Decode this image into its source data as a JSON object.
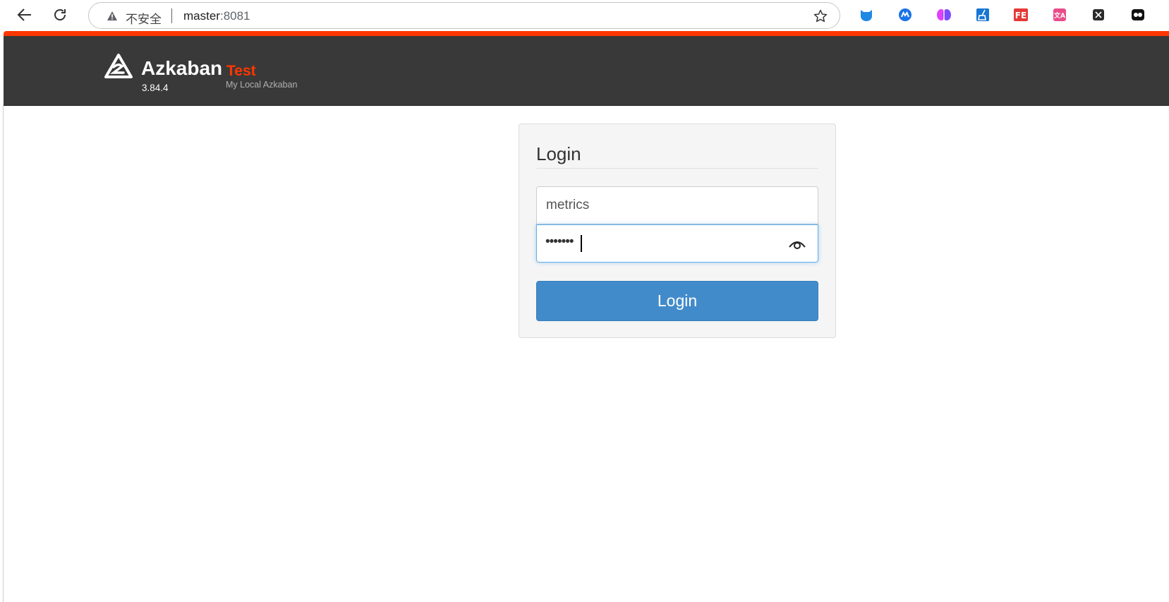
{
  "browser": {
    "security_label": "不安全",
    "url_host": "master",
    "url_port": ":8081",
    "extensions": [
      "cat-extension-icon",
      "edge-m-extension-icon",
      "brain-extension-icon",
      "broom-extension-icon",
      "fe-extension-icon",
      "translate-extension-icon",
      "x-extension-icon",
      "ghost-extension-icon"
    ]
  },
  "header": {
    "brand": "Azkaban",
    "version": "3.84.4",
    "env_name": "Test",
    "env_desc": "My Local Azkaban"
  },
  "login": {
    "title": "Login",
    "username_value": "metrics",
    "password_mask": "•••••••",
    "button_label": "Login"
  },
  "colors": {
    "accent": "#ff3601",
    "header_bg": "#393939",
    "button": "#428bca"
  }
}
